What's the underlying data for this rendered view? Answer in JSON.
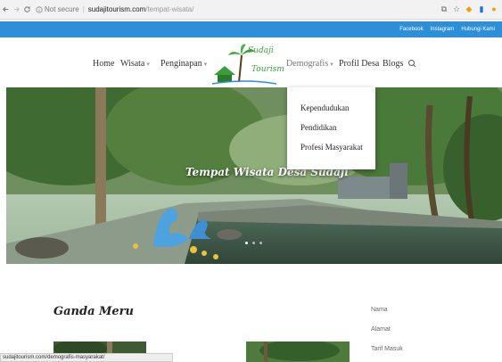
{
  "browser": {
    "back_icon": "arrow-left-icon",
    "forward_icon": "arrow-right-icon",
    "reload_icon": "reload-icon",
    "security_label": "Not secure",
    "url_host": "sudajitourism.com",
    "url_path": "/tempat-wisata/"
  },
  "topbar": {
    "links": [
      "Facebook",
      "Instagram",
      "Hubungi Kami"
    ],
    "color": "#2d8fd8"
  },
  "nav": {
    "home": "Home",
    "wisata": "Wisata",
    "penginapan": "Penginapan",
    "demografis": "Demografis",
    "profil_desa": "Profil Desa",
    "blogs": "Blogs"
  },
  "logo": {
    "line1": "Sudaji",
    "line2": "Tourism"
  },
  "dropdown": {
    "items": [
      "Kependudukan",
      "Pendidikan",
      "Profesi Masyarakat"
    ]
  },
  "hero": {
    "title": "Tempat Wisata Desa Sudaji"
  },
  "content": {
    "title": "Ganda Meru",
    "side_labels": [
      "Nama",
      "Alamat",
      "Tarif Masuk"
    ]
  },
  "status_bar": {
    "url": "sudajitourism.com/demografis-masyarakat/"
  }
}
